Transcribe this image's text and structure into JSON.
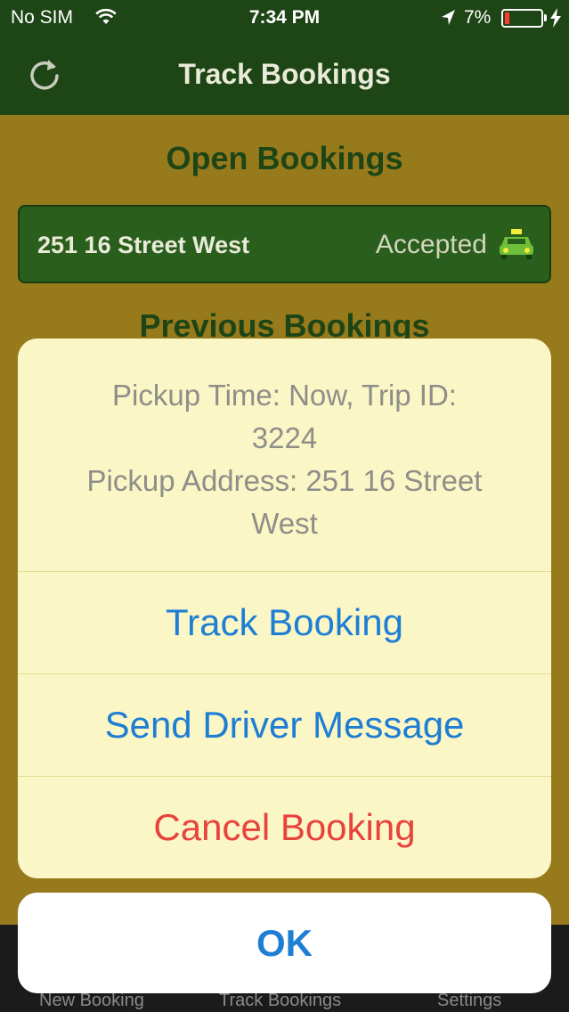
{
  "status_bar": {
    "carrier": "No SIM",
    "time": "7:34 PM",
    "battery": "7%",
    "battery_level": 0.07,
    "icons": [
      "wifi-icon",
      "location-arrow-icon",
      "battery-icon",
      "charging-bolt-icon"
    ]
  },
  "nav": {
    "title": "Track Bookings",
    "refresh_icon": "refresh-icon"
  },
  "content": {
    "open_bookings_title": "Open Bookings",
    "previous_bookings_title": "Previous Bookings",
    "bookings": [
      {
        "address": "251 16 Street West",
        "status": "Accepted",
        "icon": "taxi-icon"
      }
    ]
  },
  "tab_bar": {
    "tabs": [
      {
        "label": "New Booking"
      },
      {
        "label": "Track Bookings"
      },
      {
        "label": "Settings"
      }
    ]
  },
  "action_sheet": {
    "message_line1": "Pickup Time: Now, Trip ID:",
    "message_line2": "3224",
    "message_line3": "Pickup Address: 251 16 Street",
    "message_line4": "West",
    "actions": [
      {
        "label": "Track Booking"
      },
      {
        "label": "Send Driver Message"
      },
      {
        "label": "Cancel Booking"
      }
    ],
    "ok_label": "OK"
  },
  "colors": {
    "nav_bg": "#1e4516",
    "content_bg": "#977a1c",
    "booking_row_bg": "#2a5e1c",
    "sheet_bg": "#fbf6c6",
    "action_blue": "#1e7ed4",
    "destructive_red": "#e8423c"
  }
}
